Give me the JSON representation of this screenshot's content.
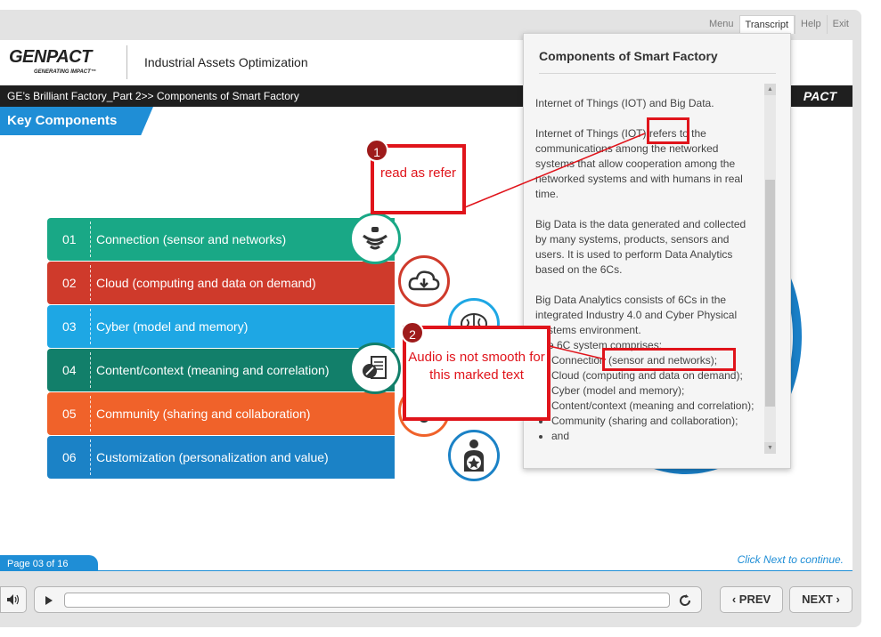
{
  "top_tabs": [
    "Menu",
    "Transcript",
    "Help",
    "Exit"
  ],
  "header": {
    "logo": "GENPACT",
    "logo_tagline": "GENERATING IMPACT™",
    "course_title": "Industrial Assets Optimization"
  },
  "breadcrumb": {
    "text": "GE’s Brilliant Factory_Part 2>> Components of Smart Factory",
    "logo_fragment": "PACT"
  },
  "section_title": "Key Components",
  "components": [
    {
      "num": "01",
      "label": "Connection (sensor and networks)",
      "icon": "sensor-waves-icon",
      "color": "#19a886"
    },
    {
      "num": "02",
      "label": "Cloud (computing and data on demand)",
      "icon": "cloud-download-icon",
      "color": "#cf3a2b"
    },
    {
      "num": "03",
      "label": "Cyber (model and memory)",
      "icon": "brain-icon",
      "color": "#1ea7e4"
    },
    {
      "num": "04",
      "label": "Content/context (meaning and correlation)",
      "icon": "document-pen-icon",
      "color": "#127f6a"
    },
    {
      "num": "05",
      "label": "Community (sharing and collaboration)",
      "icon": "community-icon",
      "color": "#f0622a"
    },
    {
      "num": "06",
      "label": "Customization (personalization and value)",
      "icon": "person-star-icon",
      "color": "#1b82c6"
    }
  ],
  "page_indicator": "Page 03 of 16",
  "continue_text": "Click Next to continue.",
  "controls": {
    "prev": "PREV",
    "next": "NEXT"
  },
  "transcript": {
    "title": "Components of Smart Factory",
    "paragraphs": [
      "Internet of Things (IOT) and Big Data.",
      "Internet of Things (IOT) refers to the communications among the networked systems that allow cooperation among the networked systems and with humans in real time.",
      "Big Data is the data generated and collected by many systems, products, sensors and users. It is used to perform Data Analytics based on the 6Cs.",
      "Big Data Analytics consists of 6Cs in the integrated Industry 4.0 and Cyber Physical Systems environment.",
      "The 6C system comprises:"
    ],
    "bullets": [
      "Connection (sensor and networks);",
      "Cloud (computing and data on demand);",
      "Cyber (model and memory);",
      "Content/context (meaning and correlation);",
      "Community (sharing and collaboration);",
      "and"
    ]
  },
  "annotations": [
    {
      "num": "1",
      "text": "read as refer"
    },
    {
      "num": "2",
      "text": "Audio is not smooth for this marked text"
    }
  ]
}
